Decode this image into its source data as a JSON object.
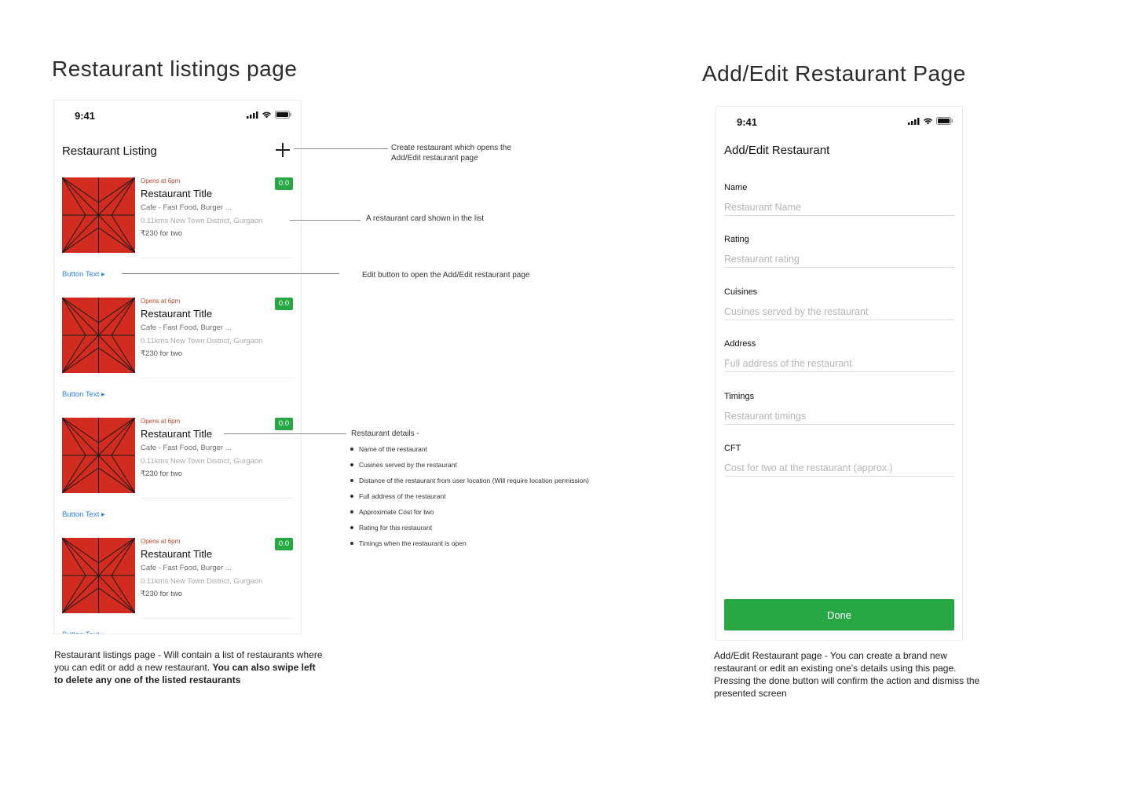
{
  "left_section": {
    "title": "Restaurant listings page",
    "phone": {
      "time": "9:41",
      "page_title": "Restaurant Listing",
      "cards": [
        {
          "opens": "Opens at 6pm",
          "title": "Restaurant Title",
          "cuisine": "Cafe - Fast Food, Burger ...",
          "distance": "0.11kms  New Town District, Gurgaon",
          "cost": "₹230 for two",
          "rating": "0.0",
          "button": "Button Text ▸"
        },
        {
          "opens": "Opens at 6pm",
          "title": "Restaurant Title",
          "cuisine": "Cafe - Fast Food, Burger ...",
          "distance": "0.11kms  New Town District, Gurgaon",
          "cost": "₹230 for two",
          "rating": "0.0",
          "button": "Button Text ▸"
        },
        {
          "opens": "Opens at 6pm",
          "title": "Restaurant Title",
          "cuisine": "Cafe - Fast Food, Burger ...",
          "distance": "0.11kms  New Town District, Gurgaon",
          "cost": "₹230 for two",
          "rating": "0.0",
          "button": "Button Text ▸"
        },
        {
          "opens": "Opens at 6pm",
          "title": "Restaurant Title",
          "cuisine": "Cafe - Fast Food, Burger ...",
          "distance": "0.11kms  New Town District, Gurgaon",
          "cost": "₹230 for two",
          "rating": "0.0",
          "button": "Button Text ▸"
        }
      ]
    },
    "annotations": {
      "create_line1": "Create restaurant which opens the",
      "create_line2": "Add/Edit restaurant page",
      "card": "A restaurant card shown in the list",
      "edit": "Edit button to open the Add/Edit restaurant page",
      "details_title": "Restaurant details -",
      "details": [
        "Name of the restaurant",
        "Cusines served by the restaurant",
        "Distance of the restaurant from user location (Will require location permission)",
        "Full address of the restaurant",
        "Approximate Cost for two",
        "Rating for this restaurant",
        "Timings when the restaurant is open"
      ]
    },
    "caption_normal": "Restaurant listings page - Will contain a list of restaurants where you can edit or add a new restaurant. ",
    "caption_bold": "You can also swipe left to delete any one of the listed restaurants"
  },
  "right_section": {
    "title": "Add/Edit Restaurant Page",
    "phone": {
      "time": "9:41",
      "page_title": "Add/Edit Restaurant",
      "fields": [
        {
          "label": "Name",
          "placeholder": "Restaurant Name",
          "value": ""
        },
        {
          "label": "Rating",
          "placeholder": "Restaurant rating",
          "value": ""
        },
        {
          "label": "Cuisines",
          "placeholder": "Cusines served by the restaurant",
          "value": ""
        },
        {
          "label": "Address",
          "placeholder": "Full address of the restaurant",
          "value": ""
        },
        {
          "label": "Timings",
          "placeholder": "Restaurant timings",
          "value": ""
        },
        {
          "label": "CFT",
          "placeholder": "Cost for two at the restaurant (approx.)",
          "value": ""
        }
      ],
      "done_label": "Done"
    },
    "caption": "Add/Edit Restaurant page - You can create a brand new restaurant or edit an existing one's details using this page. Pressing the done button will confirm the action and dismiss the presented screen"
  },
  "colors": {
    "accent_green": "#28a745",
    "thumb_red": "#d22c21",
    "link_blue": "#2f80ed",
    "opens_brown": "#b3442b"
  },
  "icons": [
    "signal-icon",
    "wifi-icon",
    "battery-icon",
    "plus-icon",
    "restaurant-thumbnail-icon"
  ]
}
